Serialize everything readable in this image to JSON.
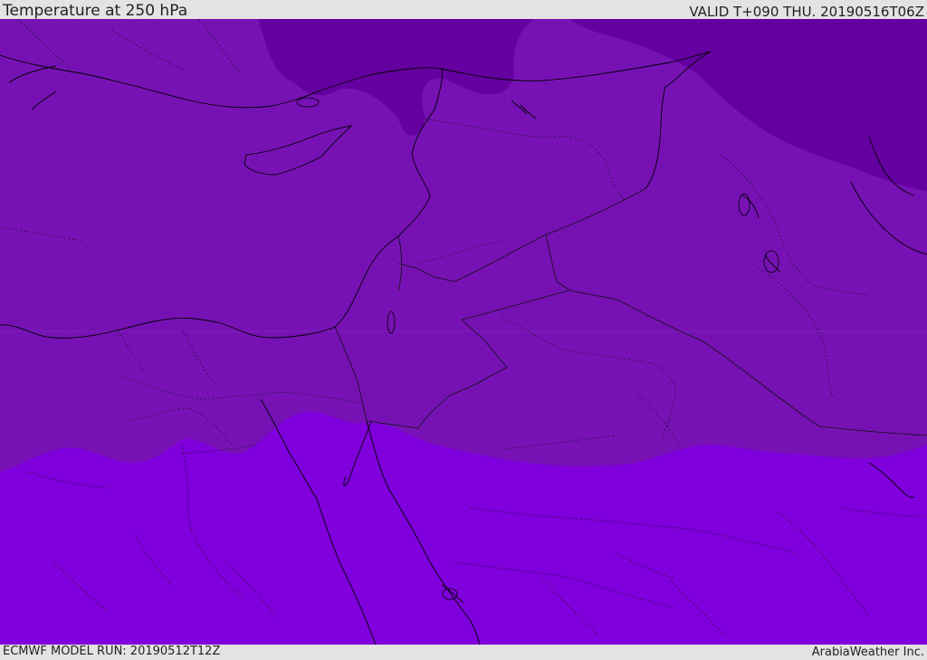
{
  "header": {
    "title": "Temperature at 250 hPa",
    "valid_time": "VALID T+090 THU. 20190516T06Z"
  },
  "footer": {
    "model_run": "ECMWF MODEL RUN: 20190512T12Z",
    "credit": "ArabiaWeather Inc."
  },
  "map": {
    "field": "temperature",
    "level": "250 hPa",
    "colors": {
      "band_cold": "#6400a0",
      "band_mid": "#7612b4",
      "band_warm": "#7f00dc",
      "coastline": "#000000",
      "border": "#222222"
    }
  }
}
